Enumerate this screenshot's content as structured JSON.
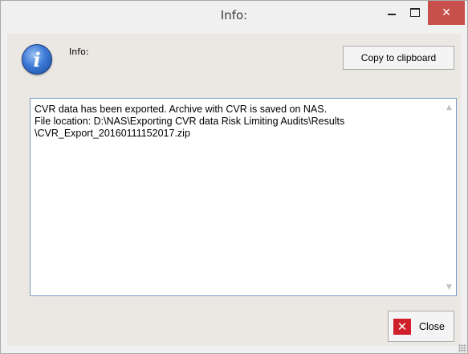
{
  "window": {
    "title": "Info:",
    "minimize_glyph": "",
    "close_glyph": "✕"
  },
  "header": {
    "icon": "info-icon",
    "icon_glyph": "i",
    "label": "Info:",
    "copy_button": "Copy to clipboard"
  },
  "message": {
    "text": "CVR data has been exported. Archive with CVR is saved on NAS.\nFile location: D:\\NAS\\Exporting CVR data Risk Limiting Audits\\Results\n\\CVR_Export_20160111152017.zip"
  },
  "footer": {
    "close_icon": "close-x-icon",
    "close_label": "Close"
  },
  "colors": {
    "close_accent": "#cf1f2a",
    "titlebar_close": "#c7504c",
    "icon_blue": "#3c7ad6"
  }
}
